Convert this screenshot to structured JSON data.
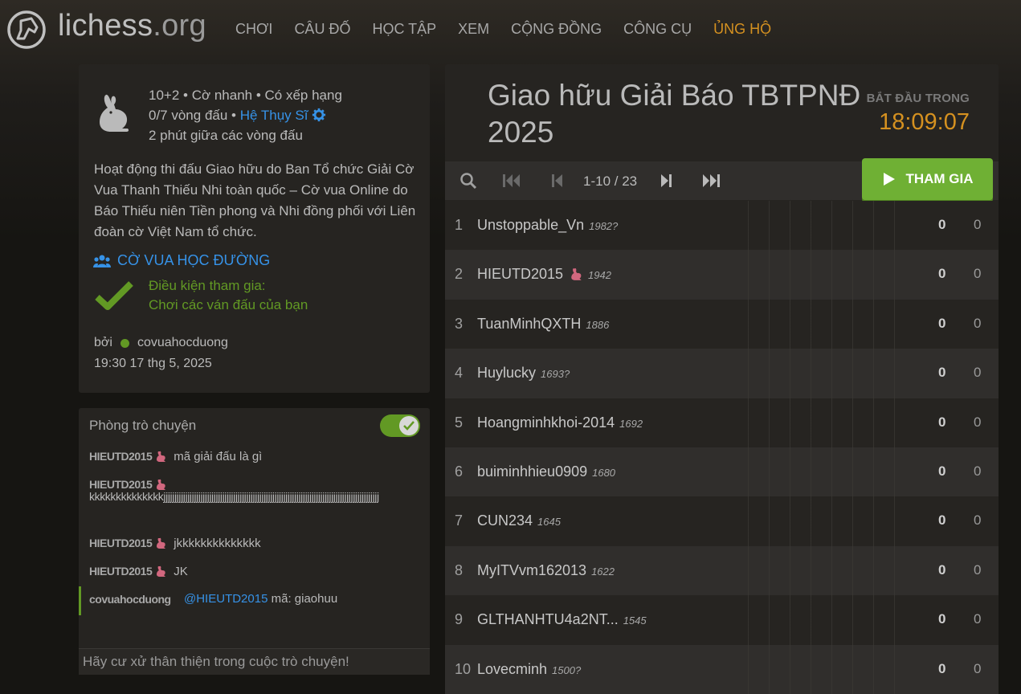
{
  "header": {
    "logo_text": "lichess",
    "logo_suffix": ".org",
    "nav": [
      "CHƠI",
      "CÂU ĐỐ",
      "HỌC TẬP",
      "XEM",
      "CỘNG ĐỒNG",
      "CÔNG CỤ",
      "ỦNG HỘ"
    ]
  },
  "info": {
    "line1": "10+2 • Cờ nhanh • Có xếp hạng",
    "line2_prefix": "0/7 vòng đấu • ",
    "line2_link": "Hệ Thụy Sĩ",
    "line3": "2 phút giữa các vòng đấu",
    "description": "Hoạt động thi đấu Giao hữu do Ban Tổ chức Giải Cờ Vua Thanh Thiếu Nhi toàn quốc – Cờ vua Online do Báo Thiếu niên Tiền phong và Nhi đồng phối với Liên đoàn cờ Việt Nam tổ chức.",
    "team": "CỜ VUA HỌC ĐƯỜNG",
    "condition_title": "Điều kiện tham gia:",
    "condition_text": "Chơi các ván đấu của bạn",
    "by_label": "bởi",
    "by_user": "covuahocduong",
    "date": "19:30 17 thg 5, 2025"
  },
  "chat": {
    "title": "Phòng trò chuyện",
    "messages": [
      {
        "user": "HIEUTD2015",
        "text": "mã giải đấu là gì"
      },
      {
        "user": "HIEUTD2015",
        "text": "kkkkkkkkkkkkkkjjjjjjjjjjjjjjjjjjjjjjjjjjjjjjjjjjjjjjjjjjjjjjjjjjjjjjjjjjjjjjjjjjjjjjjjjjjjjjjjjjjjjjjjjjjjjjjjjjj"
      },
      {
        "user": "HIEUTD2015",
        "text": "jkkkkkkkkkkkkkk"
      },
      {
        "user": "HIEUTD2015",
        "text": "JK"
      },
      {
        "user": "covuahocduong",
        "mention": "@HIEUTD2015",
        "text": " mã: giaohuu"
      }
    ],
    "placeholder": "Hãy cư xử thân thiện trong cuộc trò chuyện!"
  },
  "tournament": {
    "title": "Giao hữu Giải Báo TBTPNĐ 2025",
    "starts_label": "BẮT ĐẦU TRONG",
    "countdown": "18:09:07",
    "page_info": "1-10 / 23",
    "join_label": "THAM GIA",
    "players": [
      {
        "rank": "1",
        "name": "Unstoppable_Vn",
        "rating": "1982?",
        "score": "0",
        "perf": "0",
        "rabbit": false
      },
      {
        "rank": "2",
        "name": "HIEUTD2015",
        "rating": "1942",
        "score": "0",
        "perf": "0",
        "rabbit": true
      },
      {
        "rank": "3",
        "name": "TuanMinhQXTH",
        "rating": "1886",
        "score": "0",
        "perf": "0",
        "rabbit": false
      },
      {
        "rank": "4",
        "name": "Huylucky",
        "rating": "1693?",
        "score": "0",
        "perf": "0",
        "rabbit": false
      },
      {
        "rank": "5",
        "name": "Hoangminhkhoi-2014",
        "rating": "1692",
        "score": "0",
        "perf": "0",
        "rabbit": false
      },
      {
        "rank": "6",
        "name": "buiminhhieu0909",
        "rating": "1680",
        "score": "0",
        "perf": "0",
        "rabbit": false
      },
      {
        "rank": "7",
        "name": "CUN234",
        "rating": "1645",
        "score": "0",
        "perf": "0",
        "rabbit": false
      },
      {
        "rank": "8",
        "name": "MyITVvm162013",
        "rating": "1622",
        "score": "0",
        "perf": "0",
        "rabbit": false
      },
      {
        "rank": "9",
        "name": "GLTHANHTU4a2NT...",
        "rating": "1545",
        "score": "0",
        "perf": "0",
        "rabbit": false
      },
      {
        "rank": "10",
        "name": "Lovecminh",
        "rating": "1500?",
        "score": "0",
        "perf": "0",
        "rabbit": false
      }
    ]
  },
  "colors": {
    "accent_green": "#629924",
    "join_green": "#6fb034",
    "link_blue": "#3692e7",
    "countdown_orange": "#d59120"
  }
}
